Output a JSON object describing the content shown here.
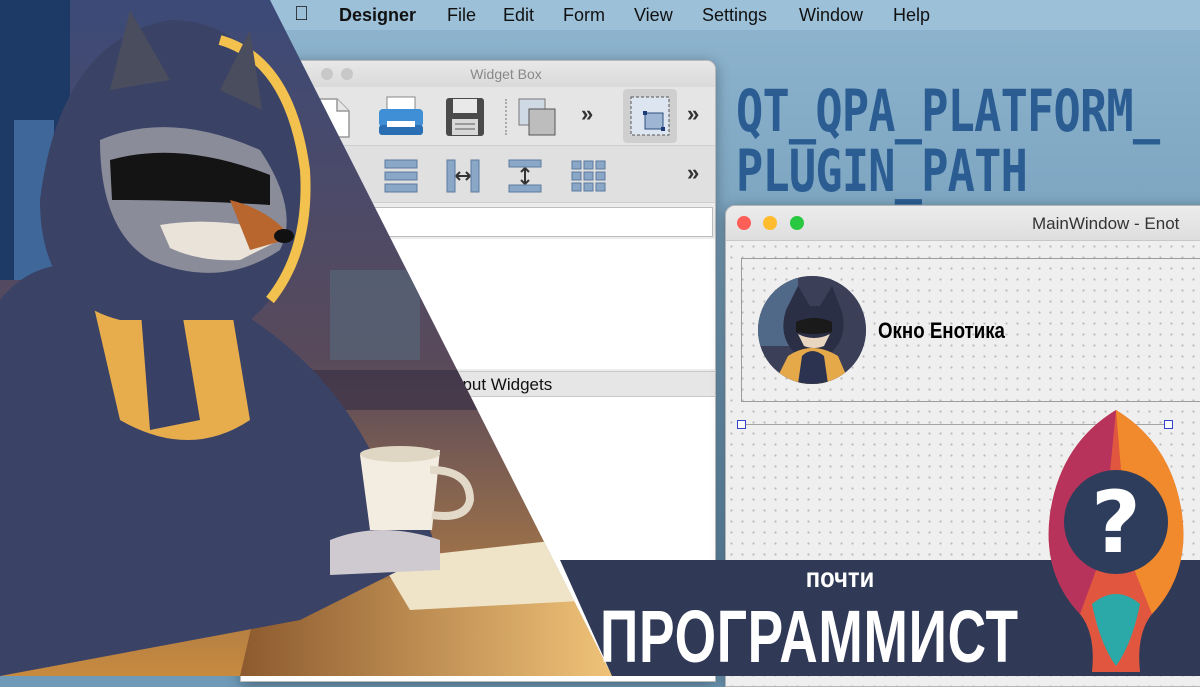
{
  "menubar": {
    "apple": "",
    "items": [
      "Designer",
      "File",
      "Edit",
      "Form",
      "View",
      "Settings",
      "Window",
      "Help"
    ]
  },
  "widget_box": {
    "title": "Widget Box",
    "chevrons": "»",
    "category_label": "nput Widgets"
  },
  "overlay": {
    "line1": "QT_QPA_PLATFORM_",
    "line2": "PLUGIN_PATH"
  },
  "main_window": {
    "title": "MainWindow - Enot",
    "label": "Окно Енотика"
  },
  "banner": {
    "small": "почти",
    "big": "ПРОГРАММИСТ"
  },
  "logo": {
    "glyph": "?"
  },
  "colors": {
    "title_blue": "#2b5d93",
    "banner_bg": "#303a57",
    "traffic_red": "#ff5f57",
    "traffic_yellow": "#febc2e",
    "traffic_green": "#28c840"
  }
}
